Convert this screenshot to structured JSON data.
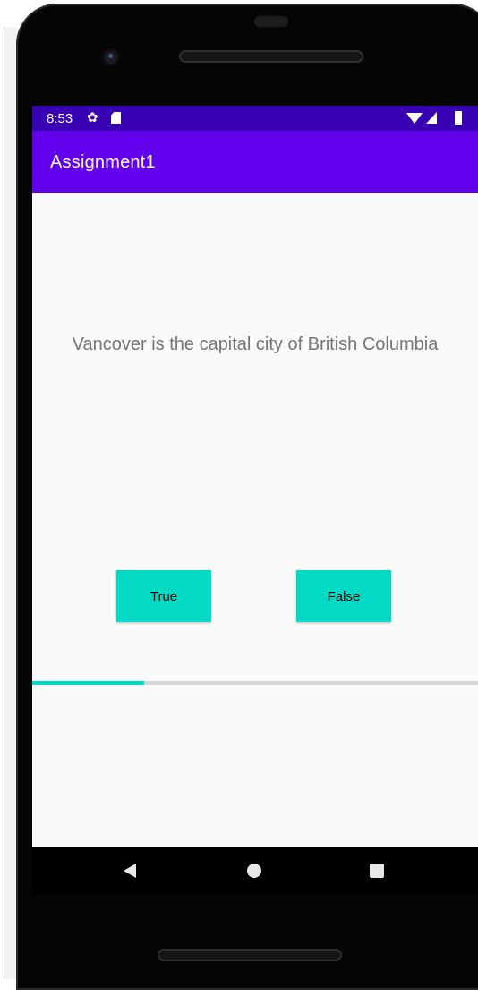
{
  "status_bar": {
    "time": "8:53",
    "icons": [
      "settings-icon",
      "sd-card-icon",
      "wifi-icon",
      "signal-icon",
      "battery-icon"
    ]
  },
  "app_bar": {
    "title": "Assignment1"
  },
  "question": {
    "text": "Vancover is the capital city of British Columbia"
  },
  "buttons": {
    "true_label": "True",
    "false_label": "False"
  },
  "progress": {
    "fraction": 0.25
  },
  "nav_bar": {
    "icons": [
      "back-icon",
      "home-icon",
      "recents-icon"
    ]
  },
  "colors": {
    "status_bar": "#3700b3",
    "app_bar": "#6200ee",
    "accent": "#03dac5",
    "question_text": "#757575"
  }
}
